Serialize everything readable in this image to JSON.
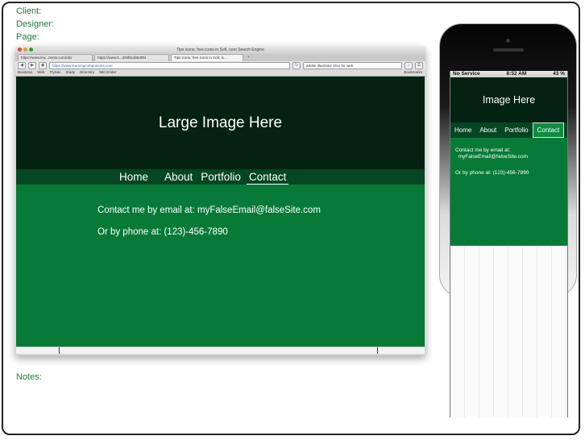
{
  "meta": {
    "client_label": "Client:",
    "designer_label": "Designer:",
    "page_label": "Page:",
    "notes_label": "Notes:"
  },
  "browser": {
    "window_title": "Tips icons, free icons in Soft, Icon Search Engine",
    "tabs": [
      {
        "label": "https://www.lea...nents.com/rdcr"
      },
      {
        "label": "https://www.b...d25f8cd0649f4"
      },
      {
        "label": "Tips icons, free icons in Soft, Ic..."
      }
    ],
    "new_tab": "+",
    "url_domain": "learningcomponents.com",
    "url_full": "https://www.learningcomponents.com",
    "search_value": "adobe illustrator slice for web",
    "bookmarks": [
      "Business",
      "Web",
      "TrySac",
      "Study",
      "Directory",
      "960 Grider"
    ],
    "bookmarks_right": "Bookmarks"
  },
  "site": {
    "hero_text": "Large Image Here",
    "nav": [
      "Home",
      "About",
      "Portfolio",
      "Contact"
    ],
    "email_line": "Contact me by email at: myFalseEmail@falseSite.com",
    "phone_line": "Or by phone at: (123)-456-7890"
  },
  "phone": {
    "carrier": "No Service",
    "time": "8:52 AM",
    "battery": "43 %",
    "hero_text": "Image Here",
    "nav": [
      "Home",
      "About",
      "Portfolio",
      "Contact"
    ],
    "email_label": "Contact me by email at:",
    "email_value": "myFalseEmail@falseSite.com",
    "phone_line": "Or by phone at: (123)-456-7890"
  },
  "colors": {
    "dark_green": "#032212",
    "nav_green": "#054623",
    "body_green": "#087a38",
    "label_green": "#1e7a3a"
  }
}
